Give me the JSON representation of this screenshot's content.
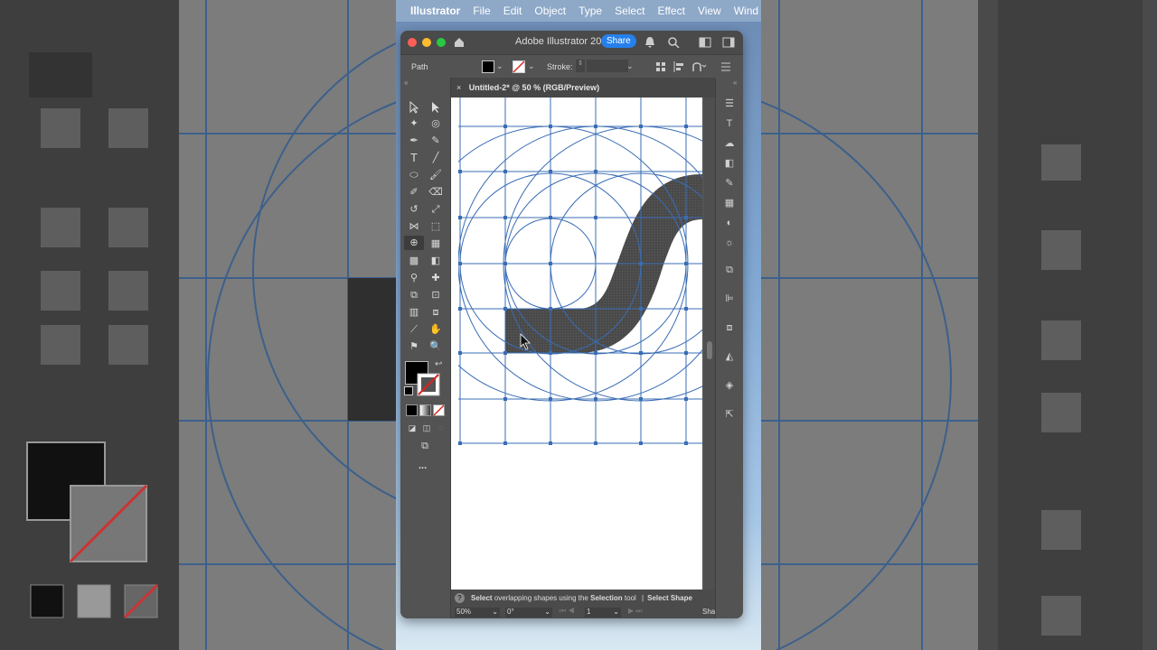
{
  "menubar": {
    "apple": "",
    "app": "Illustrator",
    "items": [
      "File",
      "Edit",
      "Object",
      "Type",
      "Select",
      "Effect",
      "View",
      "Wind"
    ]
  },
  "titlebar": {
    "title": "Adobe Illustrator 202",
    "share": "Share"
  },
  "controlbar": {
    "selection": "Path",
    "stroke_label": "Stroke:"
  },
  "document": {
    "tab_title": "Untitled-2* @ 50 % (RGB/Preview)",
    "close": "×"
  },
  "statusbar": {
    "help_select": "Select",
    "help_mid": " overlapping shapes using the ",
    "help_tool": "Selection",
    "help_end": " tool",
    "help_sep": "|",
    "help_next": "Select Shape",
    "zoom": "50%",
    "rotation": "0°",
    "artboard": "1",
    "right_label": "Sha"
  },
  "toolbar": {
    "more": "..."
  },
  "colors": {
    "accent": "#2680eb",
    "grid": "#3a6db5",
    "shape": "#4a4a4a"
  }
}
